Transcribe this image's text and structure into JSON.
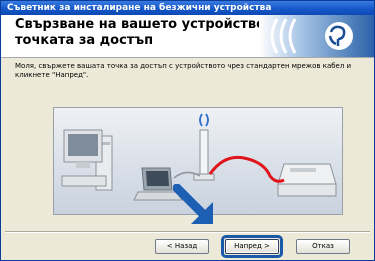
{
  "window": {
    "title": "Съветник за инсталиране на безжични устройства"
  },
  "header": {
    "title_line1": "Свързване на вашето устройство и",
    "title_line2": "точката за достъп"
  },
  "instruction": "Моля, свържете вашата точка за достъп с устройството чрез стандартен мрежов кабел и кликнете \"Напред\".",
  "buttons": {
    "back": "< Назад",
    "next": "Напред >",
    "cancel": "Отказ"
  },
  "colors": {
    "title_bar": "#1456c7",
    "ethernet_cable": "#e0141b",
    "focus_ring": "#1a5aa8"
  }
}
